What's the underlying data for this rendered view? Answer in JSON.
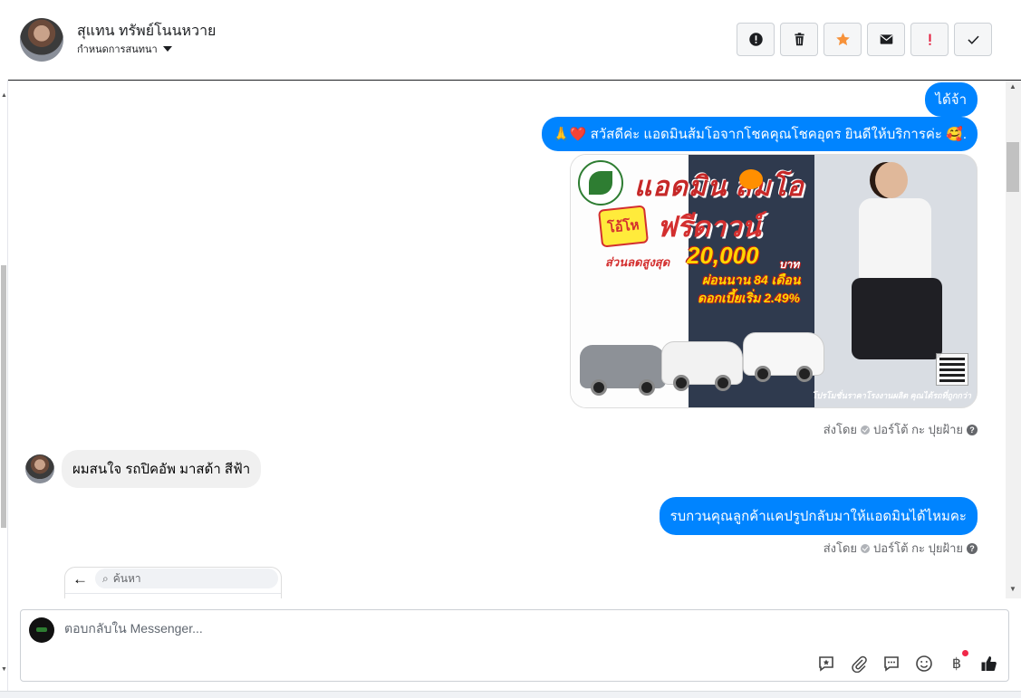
{
  "header": {
    "contact_name": "สุแทน ทรัพย์โนนหวาย",
    "assign_label": "กำหนดการสนทนา",
    "toolbar": [
      {
        "name": "mark-spam-button",
        "icon": "alert-circle-icon"
      },
      {
        "name": "delete-button",
        "icon": "trash-icon"
      },
      {
        "name": "star-button",
        "icon": "star-icon",
        "color": "#f7923a"
      },
      {
        "name": "mark-unread-button",
        "icon": "envelope-icon"
      },
      {
        "name": "follow-up-button",
        "icon": "exclamation-icon",
        "color": "#e41e3f"
      },
      {
        "name": "mark-done-button",
        "icon": "check-icon"
      }
    ]
  },
  "messages": {
    "out_1": "ได้จ้า",
    "out_2": "🙏❤️ สวัสดีค่ะ แอดมินส้มโอจากโชคคุณโชคอุดร ยินดีให้บริการค่ะ 🥰.",
    "ad": {
      "title": "แอดมิน ส้มโอ",
      "badge": "โอ้โห",
      "headline": "ฟรีดาวน์",
      "discount_label": "ส่วนลดสูงสุด",
      "amount": "20,000",
      "currency": "บาท",
      "installment": "ผ่อนนาน 84 เดือน",
      "rate": "ดอกเบี้ยเริ่ม 2.49%",
      "footer": "โปรโมชั่นราคาโรงงานผลิต คุณได้รถที่ถูกกว่า"
    },
    "sent_by_1": {
      "prefix": "ส่งโดย",
      "name": "ปอร์โต้ กะ ปุยฝ้าย"
    },
    "in_1": "ผมสนใจ รถปิคอัพ มาสด้า สีฟ้า",
    "out_3": "รบกวนคุณลูกค้าแคปรูปกลับมาให้แอดมินได้ไหมคะ",
    "sent_by_2": {
      "prefix": "ส่งโดย",
      "name": "ปอร์โต้ กะ ปุยฝ้าย"
    },
    "embed_search_placeholder": "ค้นหา"
  },
  "composer": {
    "placeholder": "ตอบกลับใน Messenger...",
    "icons": [
      "saved-reply-icon",
      "attachment-icon",
      "chat-bubble-icon",
      "emoji-icon",
      "baht-payment-icon",
      "thumbs-up-icon"
    ],
    "baht_symbol": "฿"
  }
}
